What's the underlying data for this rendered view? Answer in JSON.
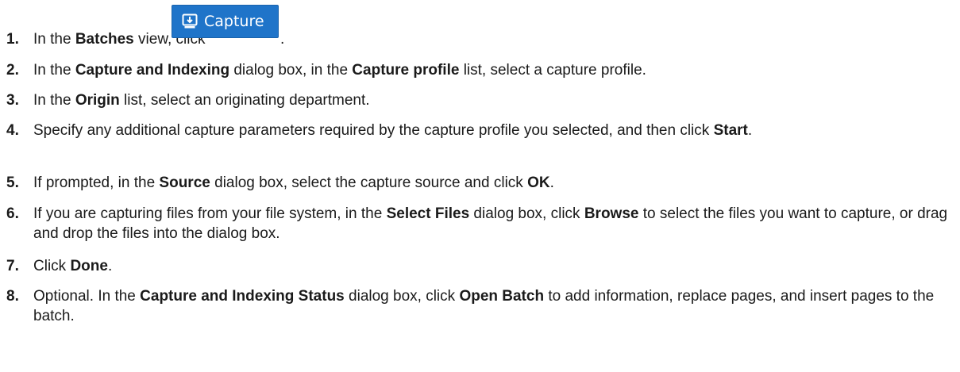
{
  "steps": [
    {
      "num": "1.",
      "parts": [
        "In the ",
        "Batches",
        " view, click "
      ],
      "bold": [
        false,
        true,
        false
      ],
      "button": {
        "label": "Capture",
        "icon": "capture-icon",
        "color": "#1f74c9"
      },
      "tail": "."
    },
    {
      "num": "2.",
      "parts": [
        "In the ",
        "Capture and Indexing",
        " dialog box, in the ",
        "Capture profile",
        " list, select a capture profile."
      ],
      "bold": [
        false,
        true,
        false,
        true,
        false
      ]
    },
    {
      "num": "3.",
      "parts": [
        "In the ",
        "Origin",
        " list, select an originating department."
      ],
      "bold": [
        false,
        true,
        false
      ]
    },
    {
      "num": "4.",
      "parts": [
        "Specify any additional capture parameters required by the capture profile you selected, and then click ",
        "Start",
        "."
      ],
      "bold": [
        false,
        true,
        false
      ]
    },
    {
      "num": "5.",
      "parts": [
        "If prompted, in the ",
        "Source",
        " dialog box, select the capture source and click ",
        "OK",
        "."
      ],
      "bold": [
        false,
        true,
        false,
        true,
        false
      ]
    },
    {
      "num": "6.",
      "parts": [
        "If you are capturing files from your file system, in the ",
        "Select Files",
        " dialog box, click ",
        "Browse",
        " to select the files you want to capture, or drag and drop the files into the dialog box."
      ],
      "bold": [
        false,
        true,
        false,
        true,
        false
      ]
    },
    {
      "num": "7.",
      "parts": [
        "Click ",
        "Done",
        "."
      ],
      "bold": [
        false,
        true,
        false
      ]
    },
    {
      "num": "8.",
      "parts": [
        "Optional. In the ",
        "Capture and Indexing Status",
        " dialog box, click ",
        "Open Batch",
        " to add information, replace pages, and insert pages to the batch."
      ],
      "bold": [
        false,
        true,
        false,
        true,
        false
      ]
    }
  ]
}
